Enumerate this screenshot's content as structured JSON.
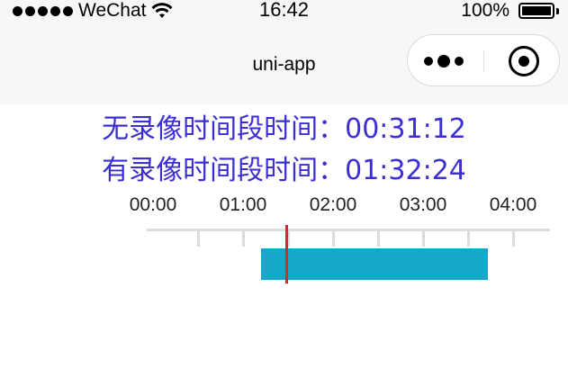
{
  "status_bar": {
    "carrier": "WeChat",
    "time": "16:42",
    "battery": "100%"
  },
  "nav_bar": {
    "title": "uni-app"
  },
  "info": {
    "no_record_label": "无录像时间段时间：",
    "no_record_value": "00:31:12",
    "record_label": "有录像时间段时间：",
    "record_value": "01:32:24"
  },
  "timeline": {
    "tick_labels": [
      "00:00",
      "01:00",
      "02:00",
      "03:00",
      "04:00"
    ],
    "start_hour": 0,
    "end_hour": 4.4,
    "recorded_segment": {
      "start": "01:12",
      "end": "03:43"
    },
    "cursor_time": "01:29",
    "colors": {
      "segment": "#16a8c9",
      "cursor": "#d32734",
      "axis": "#dcdcdc",
      "info_text": "#3b2fd3"
    }
  }
}
